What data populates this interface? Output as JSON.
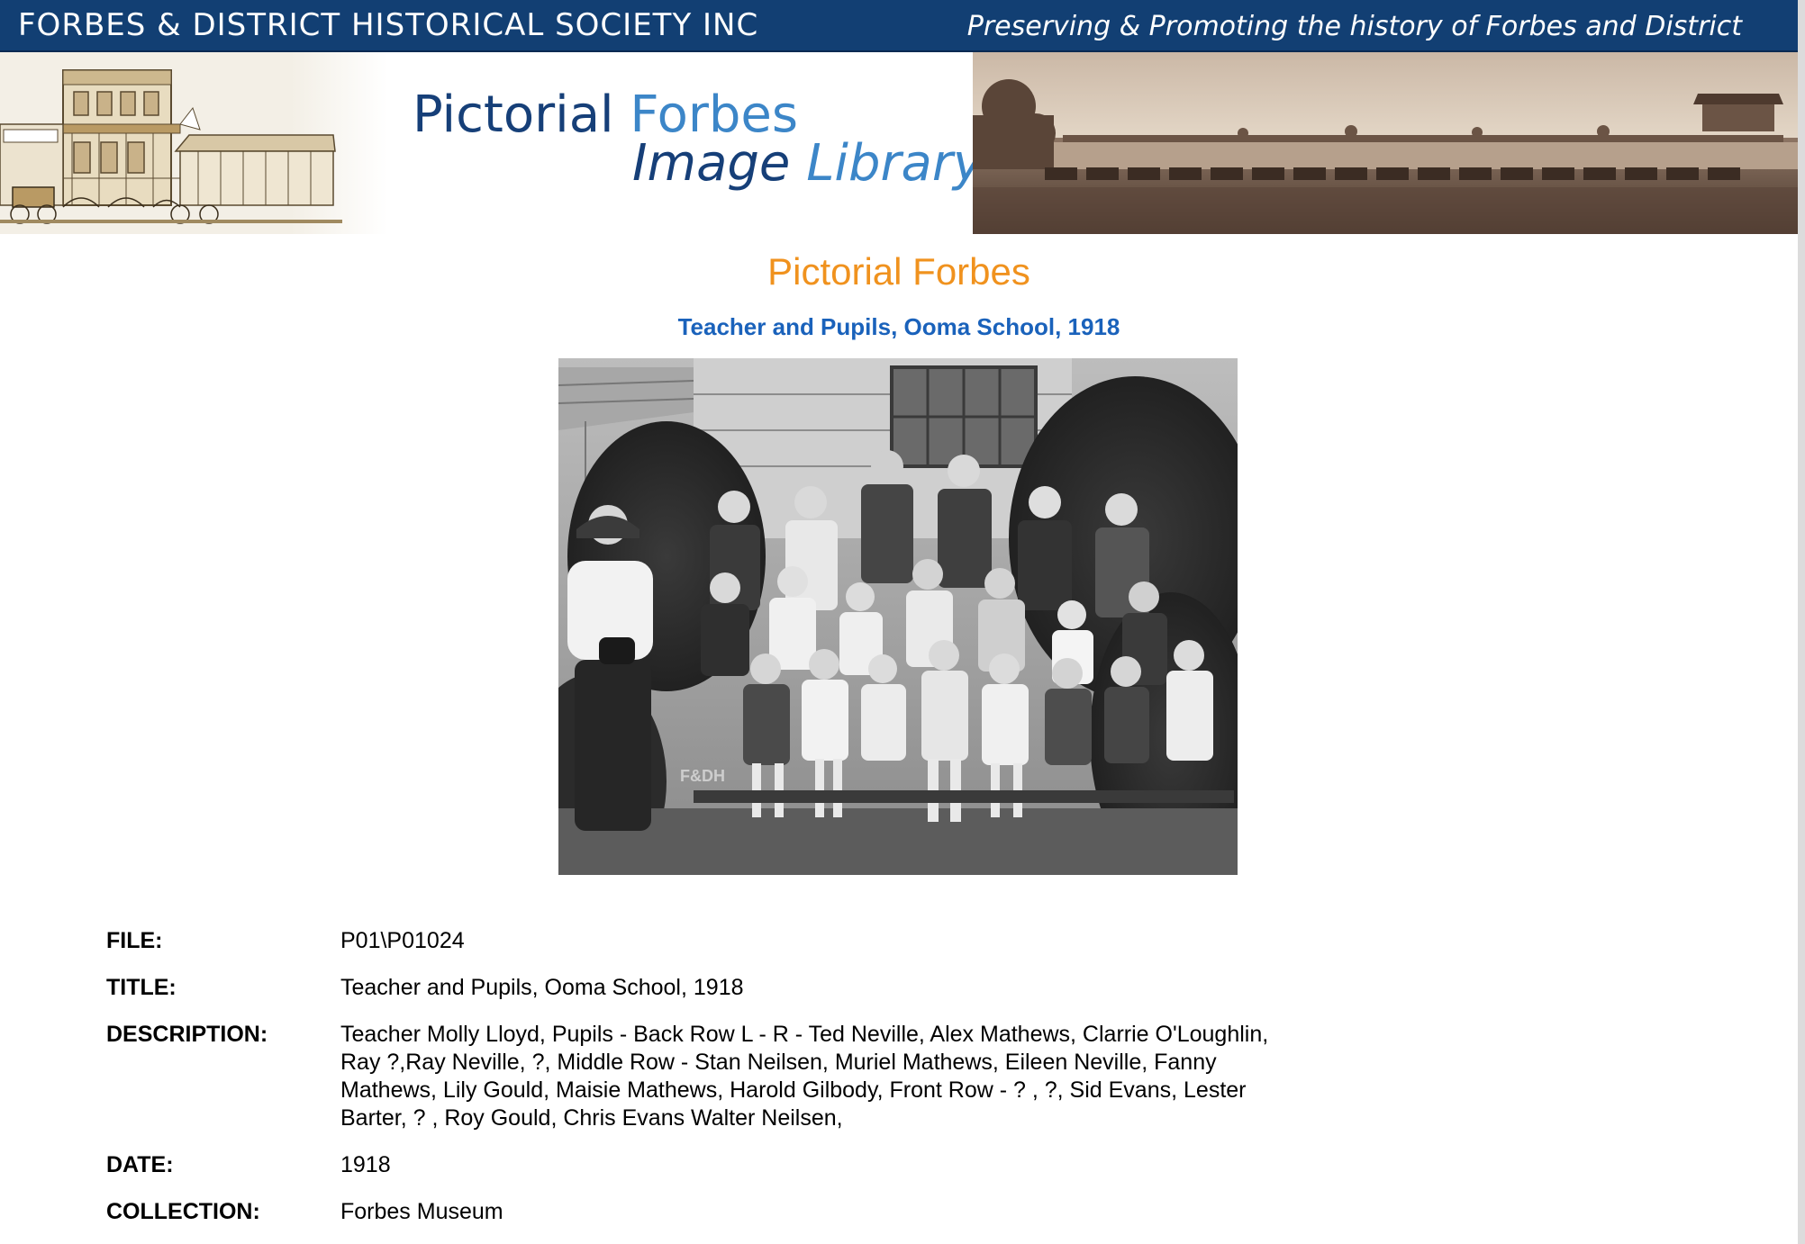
{
  "banner": {
    "society_name": "FORBES & DISTRICT HISTORICAL SOCIETY INC",
    "tagline": "Preserving & Promoting the history of Forbes and District"
  },
  "header": {
    "library_title_part1": "Pictorial",
    "library_title_part2": "Forbes",
    "library_title_part3": "Image",
    "library_title_part4": "Library"
  },
  "main": {
    "heading": "Pictorial Forbes",
    "image_title": "Teacher and Pupils, Ooma School, 1918",
    "photo_watermark": "F&DH"
  },
  "details": {
    "file_label": "FILE:",
    "file_value": "P01\\P01024",
    "title_label": "TITLE:",
    "title_value": "Teacher and Pupils, Ooma School, 1918",
    "description_label": "DESCRIPTION:",
    "description_value": "Teacher Molly Lloyd, Pupils - Back Row L - R - Ted Neville, Alex Mathews, Clarrie O'Loughlin, Ray ?,Ray Neville, ?, Middle Row - Stan Neilsen, Muriel Mathews, Eileen Neville, Fanny Mathews, Lily Gould, Maisie Mathews, Harold Gilbody, Front Row - ? , ?, Sid Evans, Lester Barter, ? , Roy Gould, Chris Evans Walter Neilsen,",
    "date_label": "DATE:",
    "date_value": "1918",
    "collection_label": "COLLECTION:",
    "collection_value": "Forbes Museum"
  },
  "colors": {
    "banner_bg": "#123f73",
    "heading_orange": "#f0921e",
    "subheading_blue": "#1a62bb",
    "title_dark_blue": "#163f78",
    "title_light_blue": "#3c86c8"
  }
}
